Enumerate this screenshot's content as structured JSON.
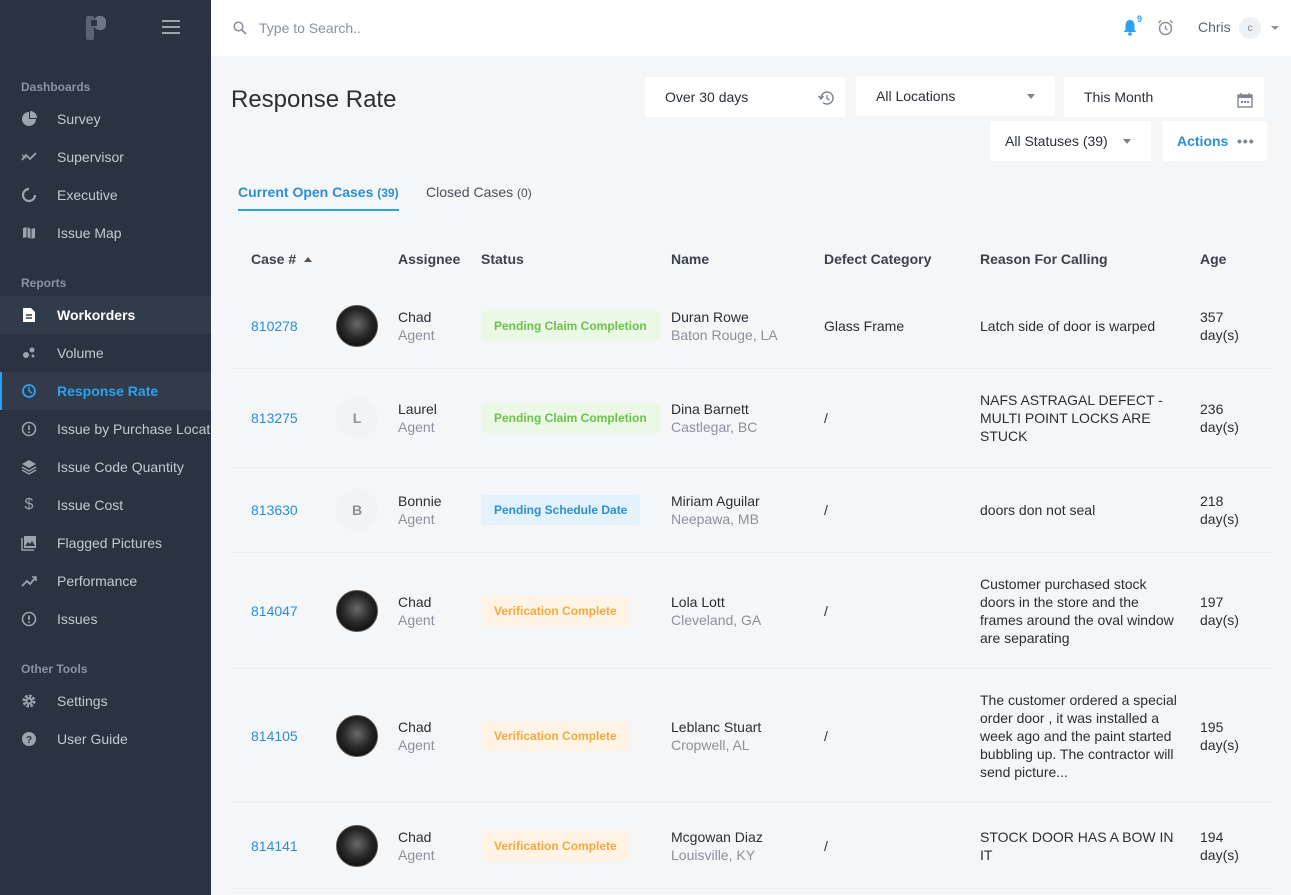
{
  "sidebar": {
    "sections": [
      "Dashboards",
      "Reports",
      "Other Tools"
    ],
    "dashboards": [
      {
        "label": "Survey",
        "icon": "pie-chart-icon"
      },
      {
        "label": "Supervisor",
        "icon": "trend-icon"
      },
      {
        "label": "Executive",
        "icon": "circle-notch-icon"
      },
      {
        "label": "Issue Map",
        "icon": "map-icon"
      }
    ],
    "reports": [
      {
        "label": "Workorders",
        "icon": "document-icon"
      },
      {
        "label": "Volume",
        "icon": "scatter-icon"
      },
      {
        "label": "Response Rate",
        "icon": "timer-icon"
      },
      {
        "label": "Issue by Purchase Location",
        "icon": "alert-circle-icon"
      },
      {
        "label": "Issue Code Quantity",
        "icon": "layers-icon"
      },
      {
        "label": "Issue Cost",
        "icon": "dollar-icon"
      },
      {
        "label": "Flagged Pictures",
        "icon": "image-icon"
      },
      {
        "label": "Performance",
        "icon": "trend-up-icon"
      },
      {
        "label": "Issues",
        "icon": "alert-circle-icon"
      }
    ],
    "other_tools": [
      {
        "label": "Settings",
        "icon": "gear-icon"
      },
      {
        "label": "User Guide",
        "icon": "help-icon"
      }
    ]
  },
  "topbar": {
    "search_placeholder": "Type to Search..",
    "notification_count": "9",
    "user_name": "Chris",
    "user_initial": "c"
  },
  "page": {
    "title": "Response Rate",
    "filters": {
      "age": "Over 30 days",
      "location": "All Locations",
      "period": "This Month",
      "status": "All Statuses (39)",
      "actions": "Actions"
    },
    "tabs": [
      {
        "label": "Current Open Cases",
        "count": "(39)"
      },
      {
        "label": "Closed Cases",
        "count": "(0)"
      }
    ]
  },
  "table": {
    "headers": [
      "Case #",
      "Assignee",
      "Status",
      "Name",
      "Defect Category",
      "Reason For Calling",
      "Age"
    ],
    "rows": [
      {
        "case": "810278",
        "avatar": "photo",
        "assignee": "Chad",
        "role": "Agent",
        "status": "Pending Claim Completion",
        "status_color": "green",
        "name": "Duran Rowe",
        "location": "Baton Rouge, LA",
        "defect": "Glass Frame",
        "reason": "Latch side of door is warped",
        "age1": "357",
        "age2": "day(s)"
      },
      {
        "case": "813275",
        "avatar": "L",
        "assignee": "Laurel",
        "role": "Agent",
        "status": "Pending Claim Completion",
        "status_color": "green",
        "name": "Dina Barnett",
        "location": "Castlegar, BC",
        "defect": "/",
        "reason": "NAFS ASTRAGAL DEFECT - MULTI POINT LOCKS ARE STUCK",
        "age1": "236",
        "age2": "day(s)"
      },
      {
        "case": "813630",
        "avatar": "B",
        "assignee": "Bonnie",
        "role": "Agent",
        "status": "Pending Schedule Date",
        "status_color": "blue",
        "name": "Miriam Aguilar",
        "location": "Neepawa, MB",
        "defect": "/",
        "reason": "doors don not seal",
        "age1": "218",
        "age2": "day(s)"
      },
      {
        "case": "814047",
        "avatar": "photo",
        "assignee": "Chad",
        "role": "Agent",
        "status": "Verification Complete",
        "status_color": "orange",
        "name": "Lola Lott",
        "location": "Cleveland, GA",
        "defect": "/",
        "reason": "Customer purchased stock doors in the store and the frames around the oval window are separating",
        "age1": "197",
        "age2": "day(s)"
      },
      {
        "case": "814105",
        "avatar": "photo",
        "assignee": "Chad",
        "role": "Agent",
        "status": "Verification Complete",
        "status_color": "orange",
        "name": "Leblanc Stuart",
        "location": "Cropwell, AL",
        "defect": "/",
        "reason": "The customer ordered a special order door , it was installed a week ago and the paint started bubbling up. The contractor will send picture...",
        "age1": "195",
        "age2": "day(s)"
      },
      {
        "case": "814141",
        "avatar": "photo",
        "assignee": "Chad",
        "role": "Agent",
        "status": "Verification Complete",
        "status_color": "orange",
        "name": "Mcgowan Diaz",
        "location": "Louisville, KY",
        "defect": "/",
        "reason": "STOCK DOOR HAS A BOW IN IT",
        "age1": "194",
        "age2": "day(s)"
      }
    ]
  }
}
